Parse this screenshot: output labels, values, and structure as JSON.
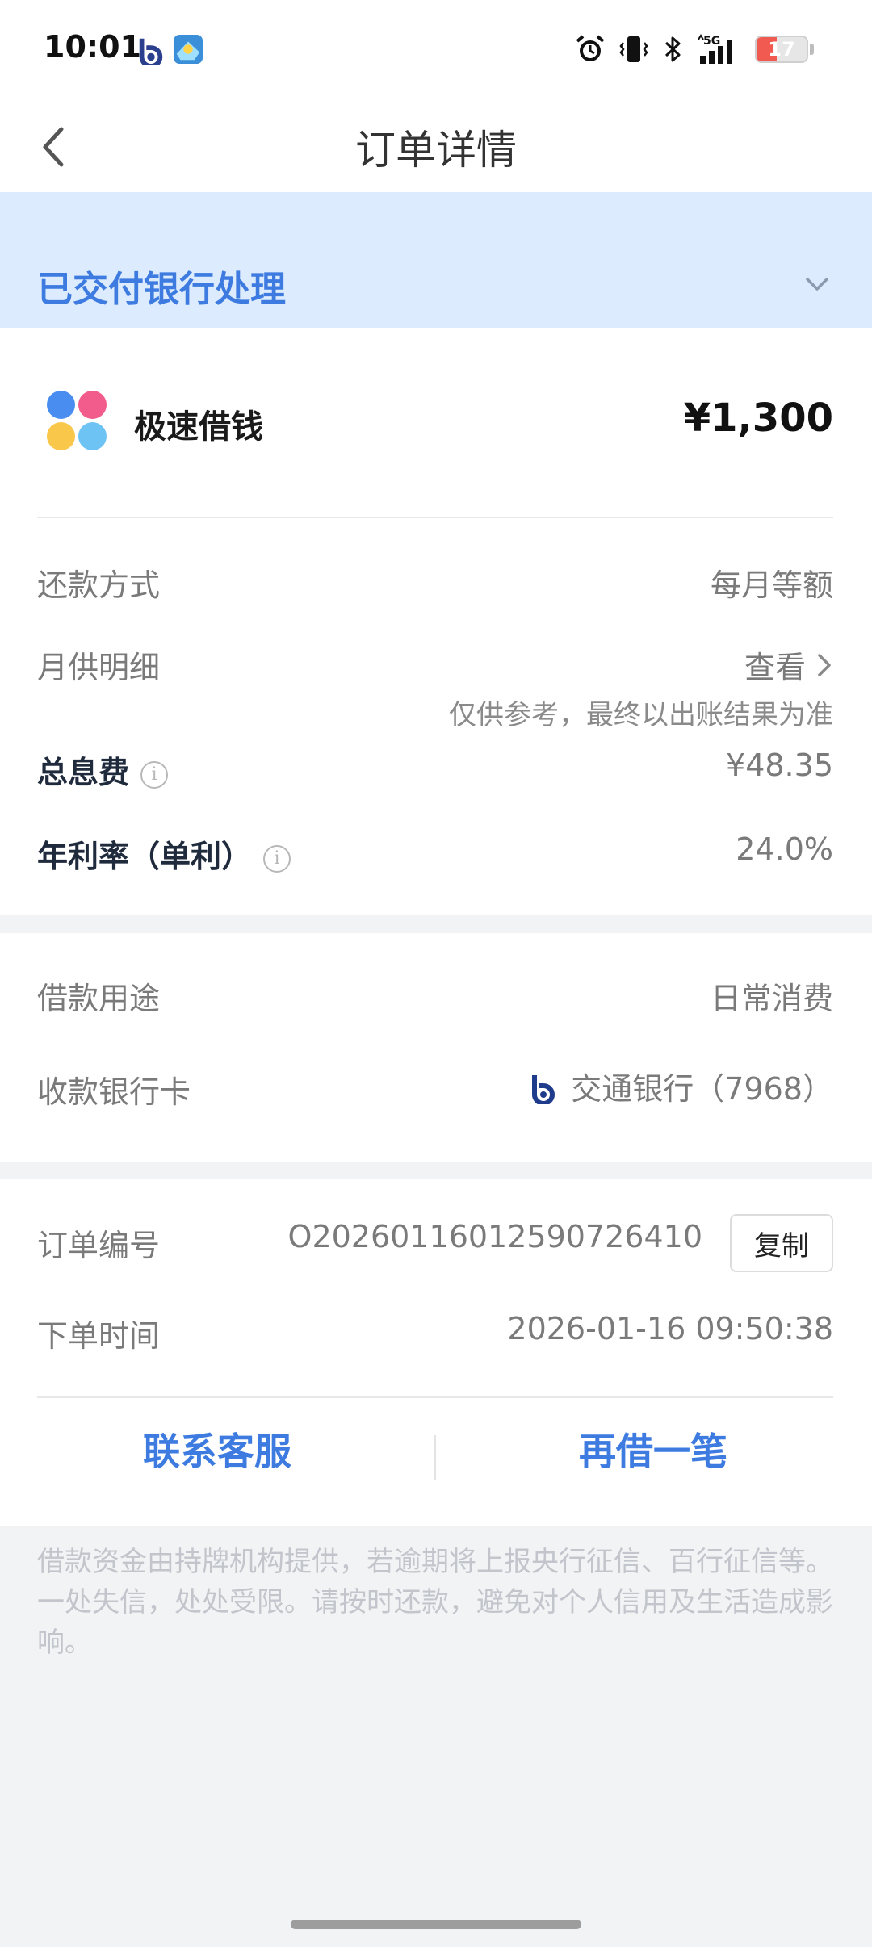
{
  "status_bar": {
    "time": "10:01",
    "battery_level": "17",
    "icons": [
      "bocom-app-icon",
      "game-app-icon",
      "alarm-icon",
      "vibrate-icon",
      "bluetooth-icon",
      "signal-5g-icon",
      "battery-icon"
    ]
  },
  "header": {
    "title": "订单详情",
    "back_icon": "chevron-left-icon"
  },
  "order_status": {
    "text": "已交付银行处理",
    "expand_icon": "chevron-down-icon"
  },
  "product": {
    "name": "极速借钱",
    "amount": "¥1,300",
    "logo_colors": [
      "#4a8df0",
      "#f25c8c",
      "#f9c74a",
      "#6ec3f5"
    ]
  },
  "repayment": {
    "method_label": "还款方式",
    "method_value": "每月等额",
    "monthly_label": "月供明细",
    "monthly_link": "查看",
    "monthly_note": "仅供参考，最终以出账结果为准",
    "interest_label": "总息费",
    "interest_value": "¥48.35",
    "rate_label": "年利率（单利）",
    "rate_value": "24.0%"
  },
  "loan_info": {
    "purpose_label": "借款用途",
    "purpose_value": "日常消费",
    "card_label": "收款银行卡",
    "card_value": "交通银行（7968）"
  },
  "order_info": {
    "number_label": "订单编号",
    "number_value": "O20260116012590726410",
    "copy_label": "复制",
    "time_label": "下单时间",
    "time_value": "2026-01-16 09:50:38"
  },
  "actions": {
    "contact": "联系客服",
    "borrow_again": "再借一笔"
  },
  "disclaimer": "借款资金由持牌机构提供，若逾期将上报央行征信、百行征信等。一处失信，处处受限。请按时还款，避免对个人信用及生活造成影响。",
  "colors": {
    "accent": "#3d7be0",
    "banner_bg": "#dcebfd",
    "page_bg": "#f2f3f4",
    "battery_low": "#f15a50"
  }
}
